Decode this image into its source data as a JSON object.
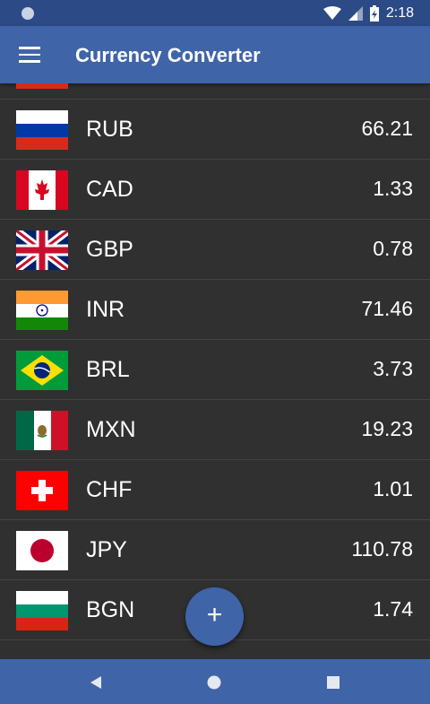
{
  "status": {
    "time": "2:18"
  },
  "app_bar": {
    "title": "Currency Converter",
    "menu_icon": "hamburger-menu-icon"
  },
  "currencies": [
    {
      "code": "RUB",
      "rate": "66.21",
      "flag": "russia-flag"
    },
    {
      "code": "CAD",
      "rate": "1.33",
      "flag": "canada-flag"
    },
    {
      "code": "GBP",
      "rate": "0.78",
      "flag": "uk-flag"
    },
    {
      "code": "INR",
      "rate": "71.46",
      "flag": "india-flag"
    },
    {
      "code": "BRL",
      "rate": "3.73",
      "flag": "brazil-flag"
    },
    {
      "code": "MXN",
      "rate": "19.23",
      "flag": "mexico-flag"
    },
    {
      "code": "CHF",
      "rate": "1.01",
      "flag": "switzerland-flag"
    },
    {
      "code": "JPY",
      "rate": "110.78",
      "flag": "japan-flag"
    },
    {
      "code": "BGN",
      "rate": "1.74",
      "flag": "bulgaria-flag"
    }
  ],
  "fab": {
    "label": "+",
    "icon": "add-icon"
  },
  "nav": {
    "back_icon": "back-icon",
    "home_icon": "home-icon",
    "recents_icon": "recents-icon"
  },
  "colors": {
    "primary": "#3f64a8",
    "status_bar": "#2c4a86",
    "background": "#303030"
  }
}
